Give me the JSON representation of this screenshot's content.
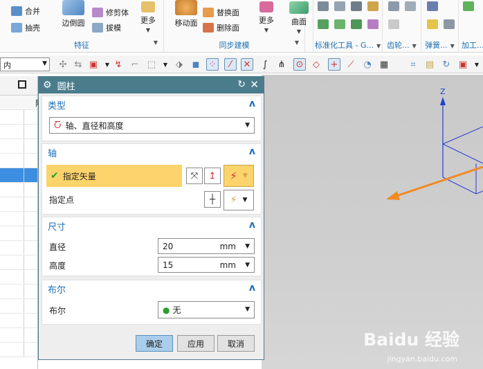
{
  "ribbon": {
    "feature_group": {
      "items": {
        "unite": "合并",
        "shell": "抽壳",
        "edge_blend": "边倒圆",
        "trim_body": "修剪体",
        "draft": "拔模",
        "more": "更多"
      },
      "label": "特征"
    },
    "sync_group": {
      "items": {
        "move_face": "移动面",
        "replace_face": "替换面",
        "delete_face": "删除面",
        "more": "更多"
      },
      "label": "同步建模"
    },
    "surface_group": {
      "label": "曲面"
    },
    "std_tools_label": "标准化工具 - G...",
    "gear_label": "齿轮...",
    "spring_label": "弹簧...",
    "machining_label": "加工..."
  },
  "toolbar2": {
    "filter_value": "内"
  },
  "dialog": {
    "title": "圆柱",
    "type_section": {
      "header": "类型",
      "value": "轴、直径和高度"
    },
    "axis_section": {
      "header": "轴",
      "specify_vector": "指定矢量",
      "specify_point": "指定点"
    },
    "dims_section": {
      "header": "尺寸",
      "diameter_label": "直径",
      "diameter_value": "20",
      "diameter_unit": "mm",
      "height_label": "高度",
      "height_value": "15",
      "height_unit": "mm"
    },
    "bool_section": {
      "header": "布尔",
      "label": "布尔",
      "value": "无"
    },
    "buttons": {
      "ok": "确定",
      "apply": "应用",
      "cancel": "取消"
    }
  },
  "viewport": {
    "axis_z": "Z",
    "watermark": "Baidu 经验",
    "watermark_url": "jingyan.baidu.com"
  },
  "left_panel": {
    "col_header": "附"
  },
  "colors": {
    "title_bar": "#4a7c8c",
    "highlight": "#fcd46b",
    "primary_button": "#a9cdea",
    "section_header": "#1e6fb5"
  }
}
